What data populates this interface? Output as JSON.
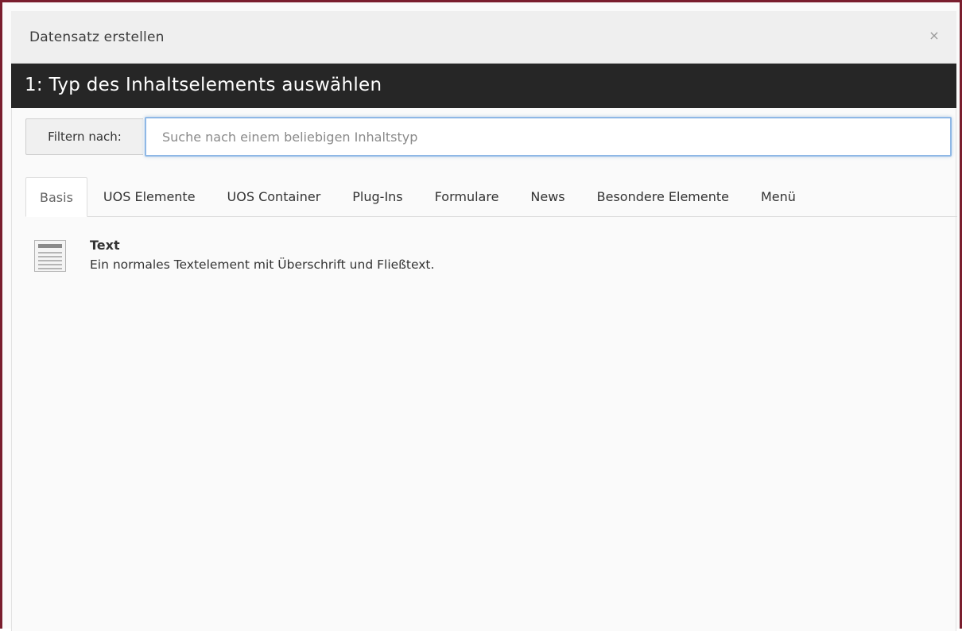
{
  "dialog": {
    "title": "Datensatz erstellen",
    "close_symbol": "×",
    "close_icon": "close-icon",
    "frame_color": "#7a1e2e"
  },
  "step": {
    "heading": "1: Typ des Inhaltselements auswählen"
  },
  "filter": {
    "label": "Filtern nach:",
    "placeholder": "Suche nach einem beliebigen Inhaltstyp",
    "value": ""
  },
  "tabs": [
    {
      "label": "Basis",
      "active": true
    },
    {
      "label": "UOS Elemente",
      "active": false
    },
    {
      "label": "UOS Container",
      "active": false
    },
    {
      "label": "Plug-Ins",
      "active": false
    },
    {
      "label": "Formulare",
      "active": false
    },
    {
      "label": "News",
      "active": false
    },
    {
      "label": "Besondere Elemente",
      "active": false
    },
    {
      "label": "Menü",
      "active": false
    }
  ],
  "items": [
    {
      "icon": "text-content-icon",
      "title": "Text",
      "description": "Ein normales Textelement mit Überschrift und Fließtext."
    }
  ]
}
